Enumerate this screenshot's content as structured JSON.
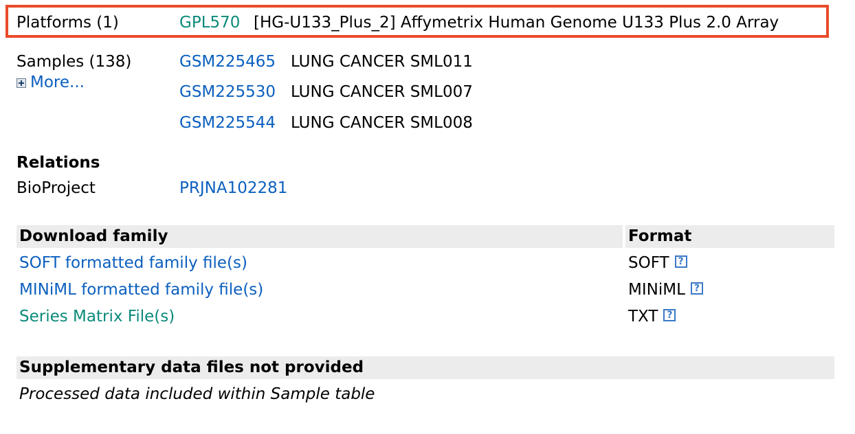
{
  "platforms": {
    "label": "Platforms (1)",
    "id": "GPL570",
    "desc": "[HG-U133_Plus_2] Affymetrix Human Genome U133 Plus 2.0 Array"
  },
  "samples": {
    "label": "Samples (138)",
    "more": "More...",
    "items": [
      {
        "id": "GSM225465",
        "desc": "LUNG CANCER SML011"
      },
      {
        "id": "GSM225530",
        "desc": "LUNG CANCER SML007"
      },
      {
        "id": "GSM225544",
        "desc": "LUNG CANCER SML008"
      }
    ]
  },
  "relations": {
    "heading": "Relations",
    "bioproject_label": "BioProject",
    "bioproject_id": "PRJNA102281"
  },
  "download": {
    "heading": "Download family",
    "format_heading": "Format",
    "rows": [
      {
        "label": "SOFT formatted family file(s)",
        "format": "SOFT",
        "help": "?"
      },
      {
        "label": "MINiML formatted family file(s)",
        "format": "MINiML",
        "help": "?"
      },
      {
        "label": "Series Matrix File(s)",
        "format": "TXT",
        "help": "?"
      }
    ]
  },
  "supplementary": {
    "heading": "Supplementary data files not provided",
    "note": "Processed data included within Sample table"
  },
  "colors": {
    "link": "#0b5fbf",
    "visited_link": "#0a8a7a",
    "highlight_border": "#ea4a2a",
    "section_bg": "#ececec"
  }
}
